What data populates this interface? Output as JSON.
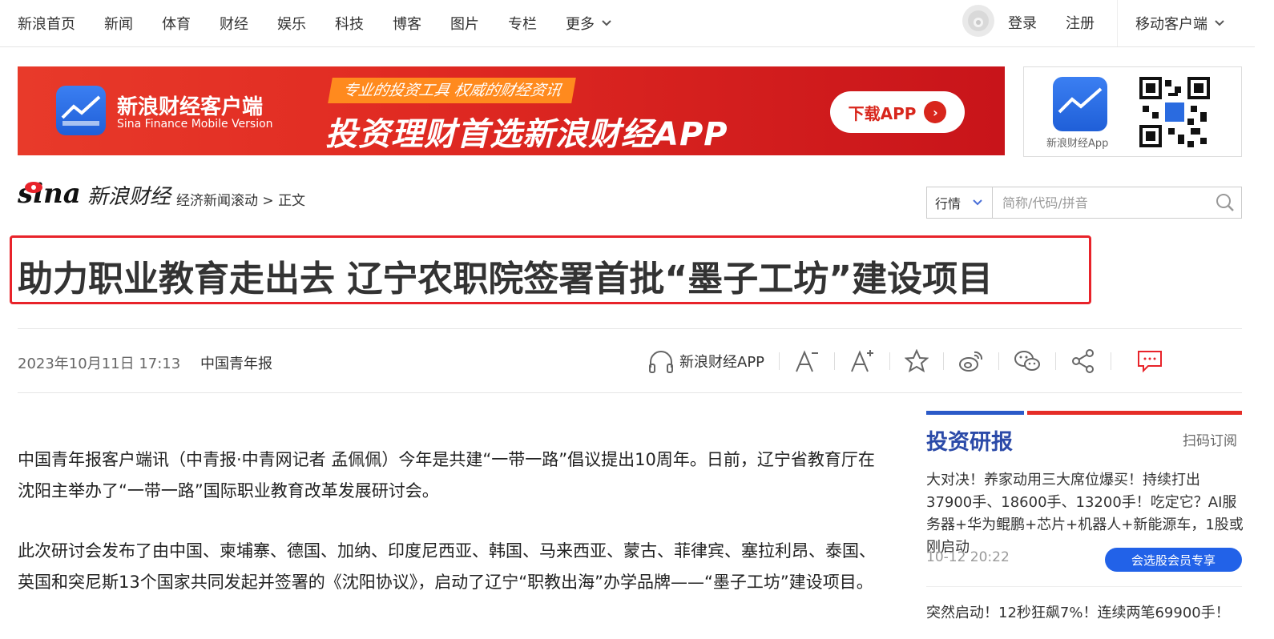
{
  "nav": {
    "links": [
      "新浪首页",
      "新闻",
      "体育",
      "财经",
      "娱乐",
      "科技",
      "博客",
      "图片",
      "专栏"
    ],
    "more": "更多",
    "login": "登录",
    "register": "注册",
    "mobile": "移动客户端"
  },
  "banner": {
    "brand_cn": "新浪财经客户端",
    "brand_en": "Sina Finance Mobile Version",
    "tag": "专业的投资工具 权威的财经资讯",
    "slogan": "投资理财首选新浪财经APP",
    "download": "下载APP",
    "qr_label": "新浪财经App"
  },
  "site": {
    "logo_sina": "sina",
    "logo_cn": "新浪财经",
    "breadcrumb_section": "经济新闻滚动",
    "breadcrumb_sep": ">",
    "breadcrumb_current": "正文"
  },
  "search": {
    "select_value": "行情",
    "placeholder": "简称/代码/拼音"
  },
  "article": {
    "title": "助力职业教育走出去 辽宁农职院签署首批“墨子工坊”建设项目",
    "date": "2023年10月11日 17:13",
    "source": "中国青年报",
    "app_label": "新浪财经APP",
    "paragraphs": [
      "中国青年报客户端讯（中青报·中青网记者 孟佩佩）今年是共建“一带一路”倡议提出10周年。日前，辽宁省教育厅在沈阳主举办了“一带一路”国际职业教育改革发展研讨会。",
      "此次研讨会发布了由中国、柬埔寨、德国、加纳、印度尼西亚、韩国、马来西亚、蒙古、菲律宾、塞拉利昂、泰国、英国和突尼斯13个国家共同发起并签署的《沈阳协议》，启动了辽宁“职教出海”办学品牌——“墨子工坊”建设项目。"
    ]
  },
  "sidebar": {
    "title": "投资研报",
    "subscribe": "扫码订阅",
    "news": [
      {
        "text": "大对决！养家动用三大席位爆买！持续打出37900手、18600手、13200手！吃定它？AI服务器+华为鲲鹏+芯片+机器人+新能源车，1股或刚启动",
        "time": "10-12 20:22",
        "badge": "会选股会员专享"
      },
      {
        "text": "突然启动！12秒狂飙7%！连续两笔69900手！"
      }
    ]
  },
  "colors": {
    "accent_red": "#e8232a",
    "brand_blue": "#2b4aa8",
    "button_blue": "#2262e8"
  }
}
